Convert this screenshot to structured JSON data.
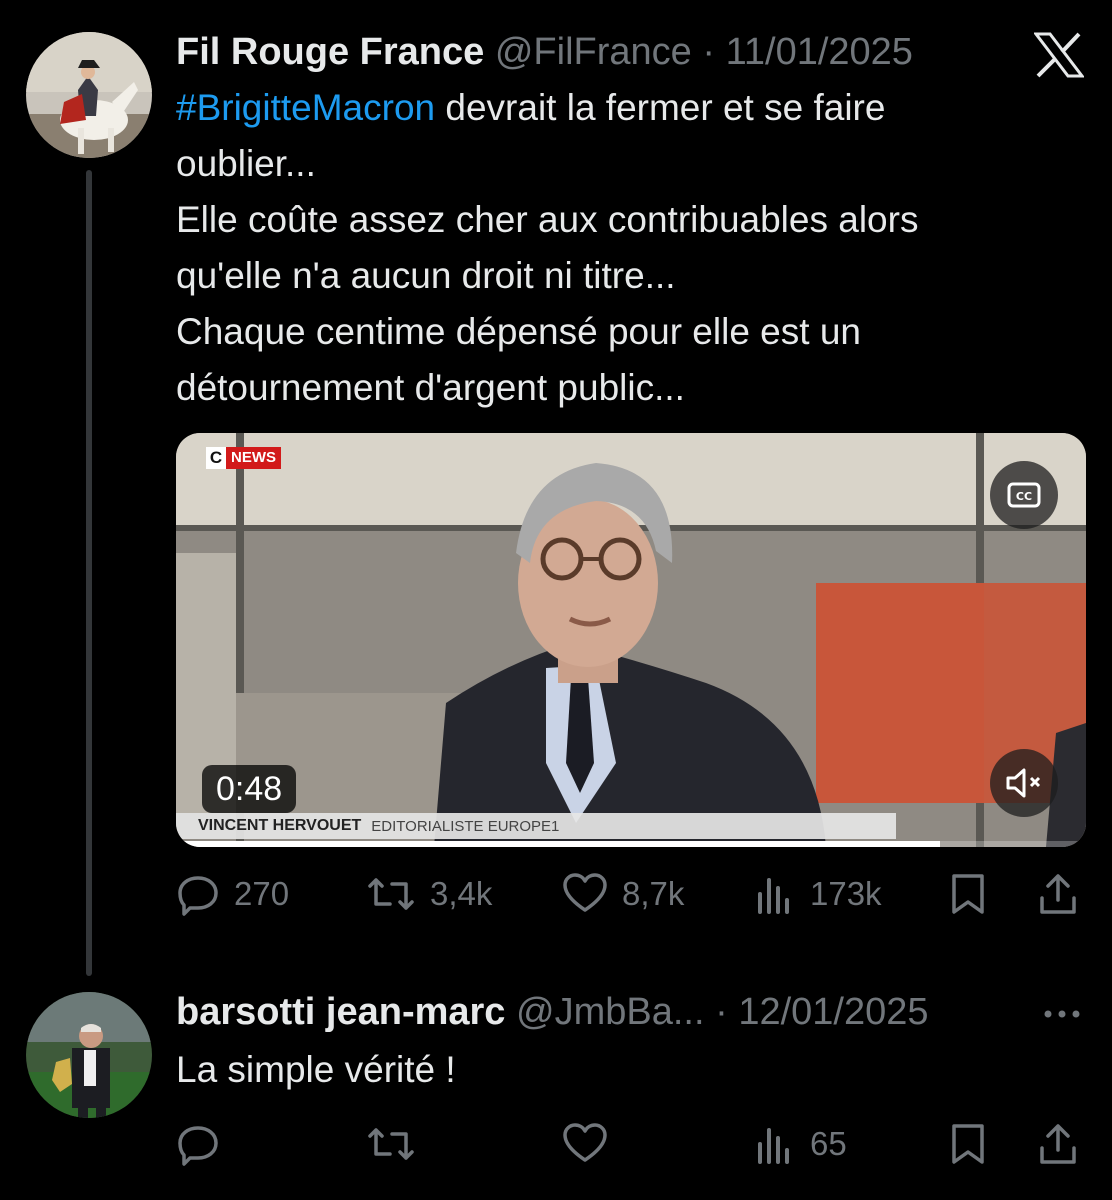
{
  "main_tweet": {
    "author_name": "Fil Rouge France",
    "handle": "@FilFrance",
    "separator": "·",
    "date": "11/01/2025",
    "hashtag": "#BrigitteMacron",
    "text_line1_rest": " devrait la fermer et se faire",
    "text_lines": [
      "oublier...",
      "Elle coûte assez cher aux contribuables alors",
      "qu'elle n'a aucun droit ni titre...",
      "Chaque centime dépensé pour elle est un",
      "détournement d'argent public..."
    ],
    "video": {
      "channel_logo_c": "C",
      "channel_logo_text": "NEWS",
      "lower_third_name": "VINCENT HERVOUET",
      "lower_third_role": "EDITORIALISTE EUROPE1",
      "duration": "0:48",
      "progress": 0.84
    },
    "stats": {
      "replies": "270",
      "reposts": "3,4k",
      "likes": "8,7k",
      "views": "173k"
    }
  },
  "reply_tweet": {
    "author_name": "barsotti jean-marc",
    "handle": "@JmbBa...",
    "separator": "·",
    "date": "12/01/2025",
    "text": "La simple vérité !",
    "stats": {
      "views": "65"
    }
  },
  "icons": {
    "platform": "x-logo",
    "reply": "reply-icon",
    "repost": "repost-icon",
    "like": "heart-icon",
    "views": "views-icon",
    "bookmark": "bookmark-icon",
    "share": "share-icon",
    "more": "more-icon",
    "captions": "cc-icon",
    "mute": "mute-icon"
  },
  "colors": {
    "background": "#000000",
    "text": "#e7e9ea",
    "secondary": "#71767b",
    "accent": "#1d9bf0",
    "thread_line": "#333639"
  }
}
